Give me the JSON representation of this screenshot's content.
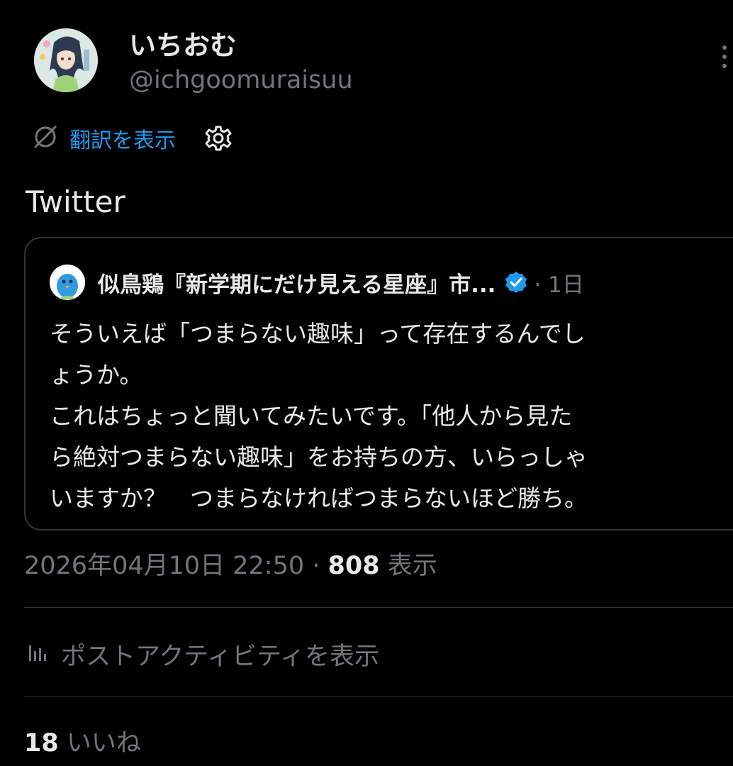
{
  "author": {
    "display_name": "いちおむ",
    "handle": "@ichgoomuraisuu"
  },
  "translate": {
    "label": "翻訳を表示"
  },
  "tweet": {
    "text": "Twitter"
  },
  "quote": {
    "author_name": "似鳥鶏『新学期にだけ見える星座』市...",
    "time": "· 1日",
    "body_lines": [
      "そういえば「つまらない趣味」って存在するんでし",
      "ょうか。",
      "これはちょっと聞いてみたいです。「他人から見た",
      "ら絶対つまらない趣味」をお持ちの方、いらっしゃ",
      "いますか？　つまらなければつまらないほど勝ち。"
    ]
  },
  "meta": {
    "timestamp": "2026年04月10日 22:50 · ",
    "views_count": "808",
    "views_label": " 表示"
  },
  "activity": {
    "label": "ポストアクティビティを表示"
  },
  "likes": {
    "count": "18",
    "label": " いいね"
  },
  "colors": {
    "background": "#000000",
    "primary_text": "#e7e9ea",
    "secondary_text": "#71767b",
    "link": "#1d9bf0",
    "border": "#2f3336",
    "verified_badge": "#1d9bf0"
  },
  "icons": {
    "translate": "translate-slash-icon",
    "settings": "gear-icon",
    "more": "more-vertical-icon",
    "verified": "verified-badge-icon",
    "activity": "bar-chart-icon"
  }
}
